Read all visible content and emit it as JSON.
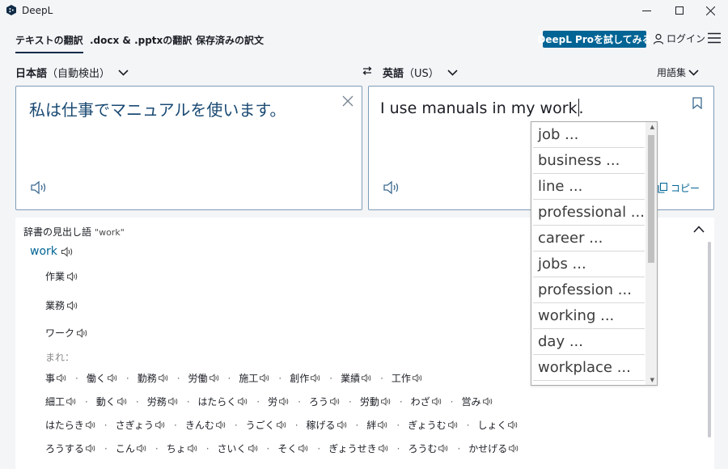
{
  "window": {
    "title": "DeepL"
  },
  "nav": {
    "tabs": [
      {
        "label": "テキストの翻訳"
      },
      {
        "label": ".docx & .pptxの翻訳"
      },
      {
        "label": "保存済みの訳文"
      }
    ],
    "pro_button": "DeepL Proを試してみる",
    "login": "ログイン"
  },
  "languages": {
    "source": "日本語",
    "source_suffix": "（自動検出）",
    "target": "英語",
    "target_suffix": "（US）",
    "glossary": "用語集"
  },
  "source_panel": {
    "text": "私は仕事でマニュアルを使います。"
  },
  "target_panel": {
    "text": "I use manuals in my work",
    "trailing": ".",
    "copy_label": "コピー"
  },
  "alternatives": [
    "job ...",
    "business ...",
    "line ...",
    "professional ...",
    "career ...",
    "jobs ...",
    "profession ...",
    "working ...",
    "day ...",
    "workplace ..."
  ],
  "dictionary": {
    "header": "辞書の見出し語",
    "query": "\"work\"",
    "headword": "work",
    "senses": [
      "作業",
      "業務",
      "ワーク"
    ],
    "rare_label": "まれ：",
    "rare_rows": [
      [
        "事",
        "働く",
        "勤務",
        "労働",
        "施工",
        "創作",
        "業績",
        "工作"
      ],
      [
        "細工",
        "動く",
        "労務",
        "はたらく",
        "労",
        "ろう",
        "労動",
        "わざ",
        "営み"
      ],
      [
        "はたらき",
        "さぎょう",
        "きんむ",
        "うごく",
        "稼げる",
        "絆",
        "ぎょうむ",
        "しょく"
      ],
      [
        "ろうする",
        "こん",
        "ちょ",
        "さいく",
        "そく",
        "ぎょうせき",
        "ろうむ",
        "かせげる"
      ]
    ]
  },
  "colors": {
    "accent": "#006494",
    "source_text": "#1a4a73",
    "panel_border": "#7e9cb8"
  }
}
